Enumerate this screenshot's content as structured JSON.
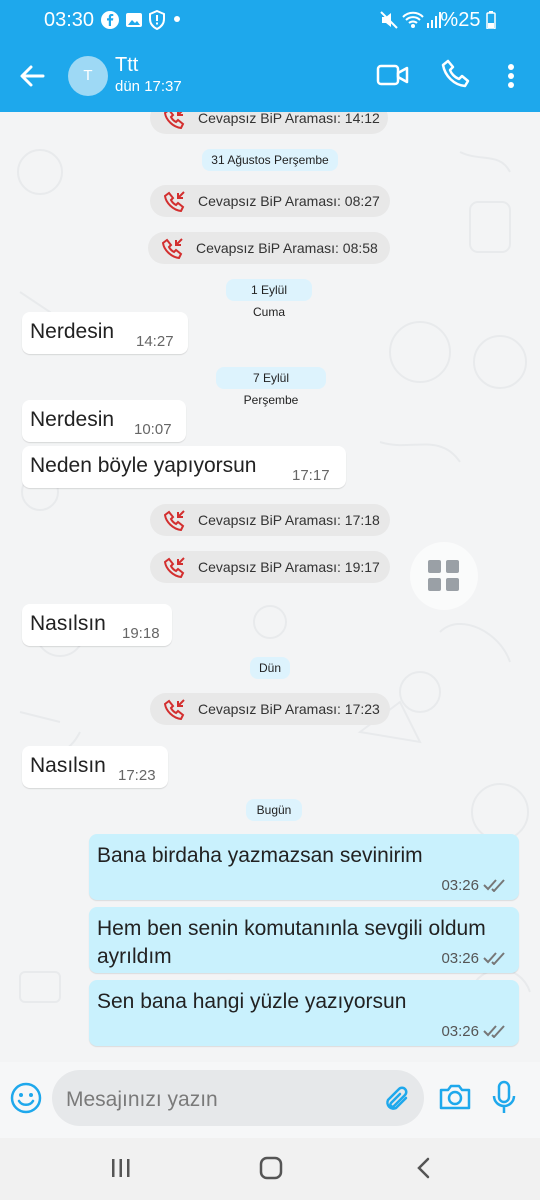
{
  "status_bar": {
    "time": "03:30",
    "battery": "%25"
  },
  "contact": {
    "avatar_initial": "T",
    "name": "Ttt",
    "last_seen": "dün 17:37"
  },
  "messages": [
    {
      "kind": "call",
      "text": "Cevapsız BiP Araması: 14:12"
    },
    {
      "kind": "date",
      "text": "31 Ağustos Perşembe"
    },
    {
      "kind": "call",
      "text": "Cevapsız BiP Araması: 08:27"
    },
    {
      "kind": "call",
      "text": "Cevapsız BiP Araması: 08:58"
    },
    {
      "kind": "date",
      "text": "1 Eylül Cuma"
    },
    {
      "kind": "in",
      "text": "Nerdesin",
      "time": "14:27"
    },
    {
      "kind": "date",
      "text": "7 Eylül Perşembe"
    },
    {
      "kind": "in",
      "text": "Nerdesin",
      "time": "10:07"
    },
    {
      "kind": "in",
      "text": "Neden böyle yapıyorsun",
      "time": "17:17"
    },
    {
      "kind": "call",
      "text": "Cevapsız BiP Araması: 17:18"
    },
    {
      "kind": "call",
      "text": "Cevapsız BiP Araması: 19:17"
    },
    {
      "kind": "in",
      "text": "Nasılsın",
      "time": "19:18"
    },
    {
      "kind": "date",
      "text": "Dün"
    },
    {
      "kind": "call",
      "text": "Cevapsız BiP Araması: 17:23"
    },
    {
      "kind": "in",
      "text": "Nasılsın",
      "time": "17:23"
    },
    {
      "kind": "date",
      "text": "Bugün"
    },
    {
      "kind": "out",
      "text": "Bana birdaha yazmazsan sevinirim",
      "time": "03:26"
    },
    {
      "kind": "out",
      "text": "Hem ben senin komutanınla sevgili oldum ayrıldım",
      "time": "03:26"
    },
    {
      "kind": "out",
      "text": "Sen bana hangi yüzle yazıyorsun",
      "time": "03:26"
    }
  ],
  "composer": {
    "placeholder": "Mesajınızı yazın"
  },
  "icons": {
    "back": "back-arrow-icon",
    "video": "video-call-icon",
    "phone": "phone-icon",
    "more": "more-vert-icon",
    "missed_call": "missed-call-icon",
    "emoji": "emoji-icon",
    "attach": "paperclip-icon",
    "camera": "camera-icon",
    "mic": "mic-icon",
    "double_check": "double-check-icon"
  },
  "colors": {
    "brand": "#1ea8ec",
    "outgoing_bubble": "#c9f1fd",
    "missed_call": "#d32f2f",
    "date_chip": "#ddf3fd"
  }
}
